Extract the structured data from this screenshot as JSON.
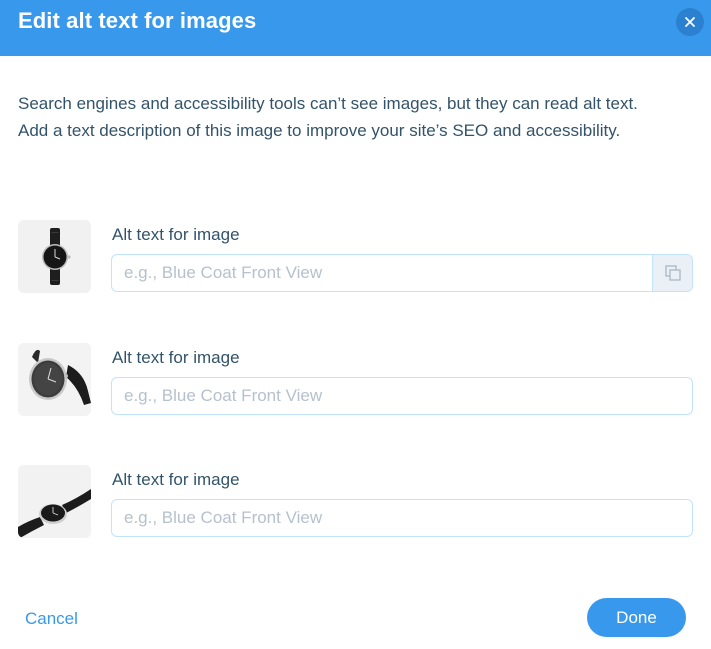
{
  "dialog": {
    "title": "Edit alt text for images",
    "description": "Search engines and accessibility tools can’t see images, but they can read alt text. Add a text description of this image to improve your site’s SEO and accessibility."
  },
  "images": [
    {
      "thumbnail": "watch-front-image",
      "label": "Alt text for image",
      "value": "",
      "placeholder": "e.g., Blue Coat Front View",
      "has_copy_button": true
    },
    {
      "thumbnail": "watch-angle-image",
      "label": "Alt text for image",
      "value": "",
      "placeholder": "e.g., Blue Coat Front View",
      "has_copy_button": false
    },
    {
      "thumbnail": "watch-side-image",
      "label": "Alt text for image",
      "value": "",
      "placeholder": "e.g., Blue Coat Front View",
      "has_copy_button": false
    }
  ],
  "footer": {
    "cancel_label": "Cancel",
    "done_label": "Done"
  },
  "icons": {
    "close": "close-icon",
    "copy": "copy-icon"
  },
  "colors": {
    "header_bg": "#3899ec",
    "accent": "#3899ec",
    "text": "#32536a",
    "placeholder": "#b6c1cd",
    "input_border": "#c1e4fe"
  }
}
